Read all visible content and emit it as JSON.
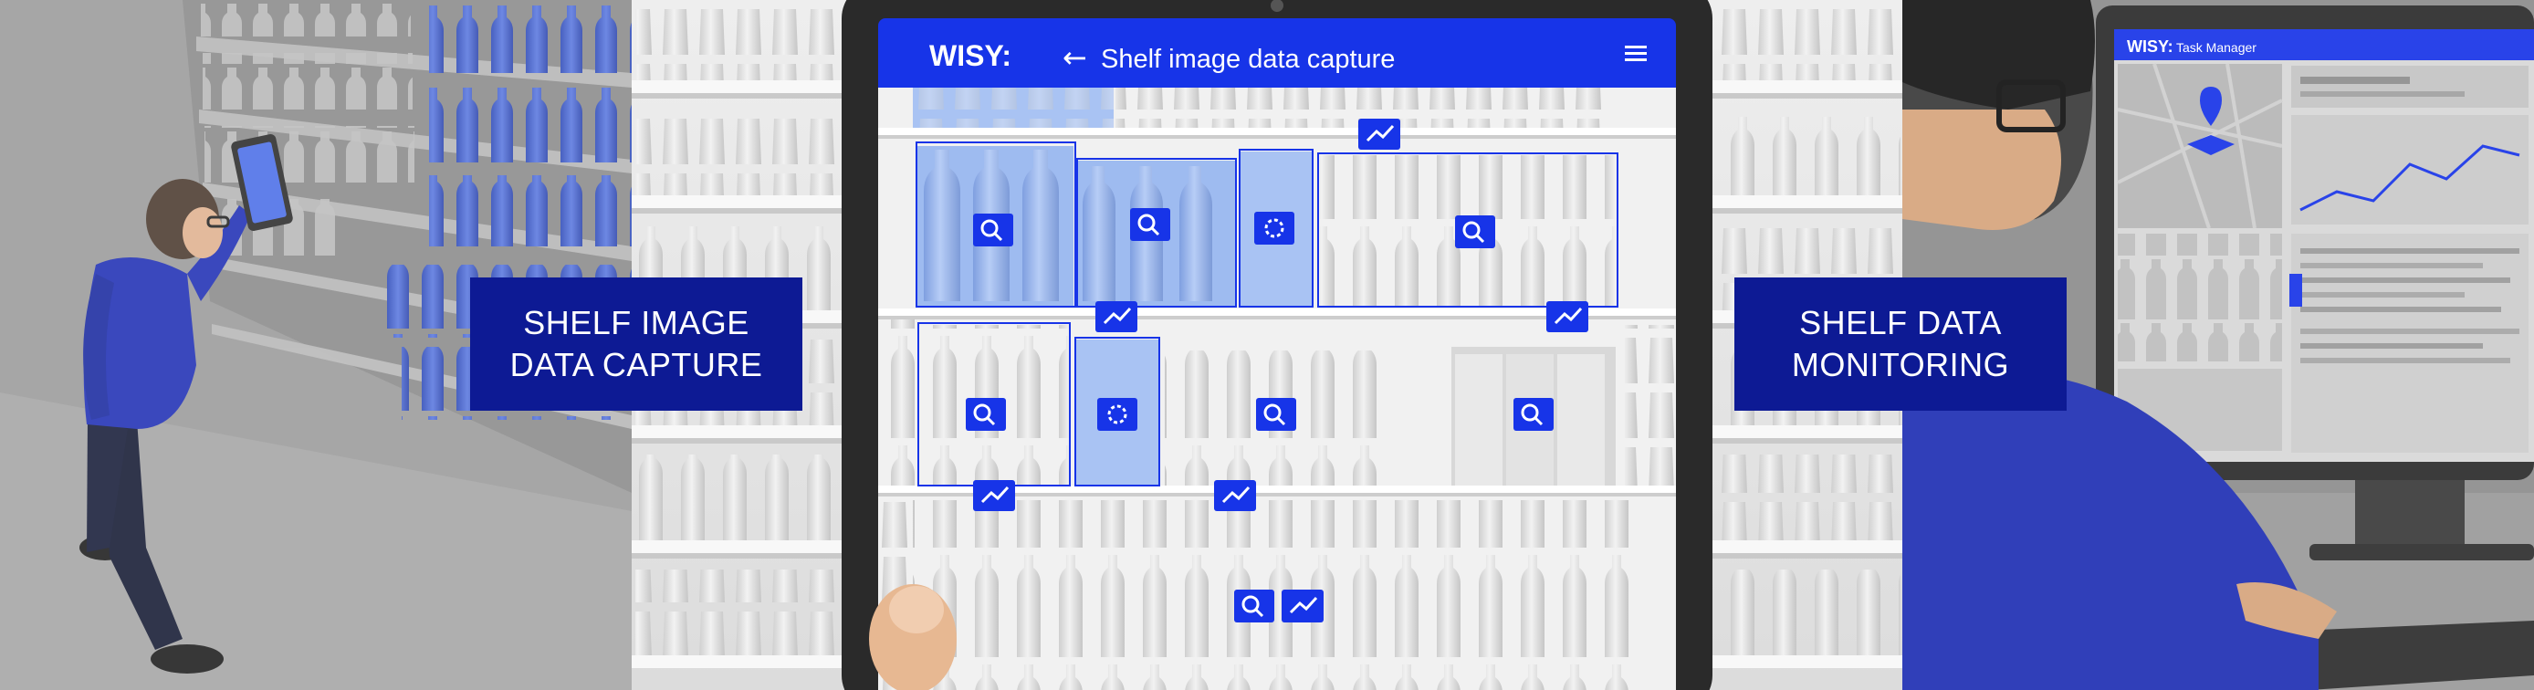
{
  "left_label": {
    "line1": "SHELF IMAGE",
    "line2": "DATA CAPTURE"
  },
  "right_label": {
    "line1": "SHELF DATA",
    "line2": "MONITORING"
  },
  "tablet": {
    "brand": "WISY:",
    "back_arrow": "←",
    "title": "Shelf image data capture",
    "menu_icon": "hamburger-menu-icon"
  },
  "monitor": {
    "brand": "WISY:",
    "subtitle": "Task Manager"
  },
  "colors": {
    "brand_blue": "#1734e8",
    "label_navy": "#0d1a94",
    "highlight_blue": "#9ebbf0"
  }
}
